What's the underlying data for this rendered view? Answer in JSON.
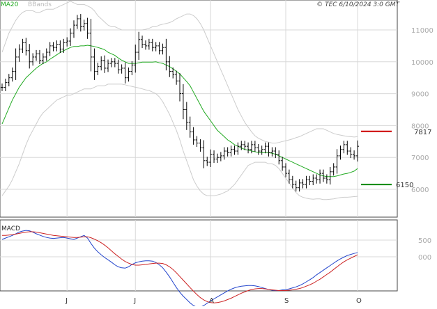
{
  "header": {
    "legend_ma": "MA20",
    "legend_bb": "BBands",
    "copyright": "© TEC 6/10/2024 3:0 GMT"
  },
  "colors": {
    "ma": "#22aa22",
    "bbands": "#cccccc",
    "price": "#000000",
    "macd_line": "#2244cc",
    "signal_line": "#cc2222",
    "resistance": "#cc0000",
    "support": "#008800",
    "grid": "#d8d8d8"
  },
  "chart_data": [
    {
      "type": "line",
      "subtype": "ohlc",
      "title": "",
      "y_ticks": [
        "11000",
        "10000",
        "9000",
        "8000",
        "7000",
        "6000"
      ],
      "y_tick_values": [
        11000,
        10000,
        9000,
        8000,
        7000,
        6000
      ],
      "ylim": [
        5300,
        11900
      ],
      "x_month_labels": [
        "J",
        "J",
        "A",
        "S",
        "O"
      ],
      "x_month_index": [
        19,
        39,
        61,
        83,
        104
      ],
      "grid": true,
      "levels": [
        {
          "name": "resistance",
          "value": 7817,
          "label": "7817"
        },
        {
          "name": "support",
          "value": 6150,
          "label": "6150"
        }
      ],
      "close": [
        9200,
        9350,
        9500,
        9700,
        10150,
        10400,
        10600,
        10350,
        10000,
        10150,
        10250,
        10050,
        10150,
        10300,
        10500,
        10450,
        10550,
        10400,
        10600,
        10650,
        10900,
        11150,
        11350,
        11100,
        11200,
        10900,
        10150,
        9700,
        9850,
        10050,
        9800,
        9950,
        10000,
        9950,
        9750,
        9800,
        9500,
        9700,
        9900,
        10300,
        10700,
        10550,
        10500,
        10600,
        10450,
        10500,
        10350,
        10450,
        10000,
        9700,
        9600,
        9400,
        9000,
        8500,
        8100,
        7800,
        7550,
        7450,
        7300,
        6900,
        6850,
        7100,
        6950,
        7000,
        7050,
        7200,
        7150,
        7250,
        7200,
        7350,
        7400,
        7350,
        7250,
        7400,
        7300,
        7200,
        7250,
        7350,
        7150,
        7200,
        7100,
        6900,
        6700,
        6500,
        6300,
        6150,
        6050,
        6200,
        6150,
        6300,
        6250,
        6350,
        6300,
        6500,
        6350,
        6300,
        6550,
        6700,
        7050,
        7250,
        7400,
        7200,
        7100,
        7050,
        7350
      ],
      "ma20": [
        8050,
        8300,
        8550,
        8800,
        9000,
        9200,
        9350,
        9500,
        9600,
        9700,
        9800,
        9880,
        9950,
        10000,
        10080,
        10150,
        10220,
        10290,
        10350,
        10400,
        10450,
        10480,
        10480,
        10500,
        10500,
        10520,
        10500,
        10480,
        10450,
        10420,
        10380,
        10300,
        10250,
        10200,
        10120,
        10050,
        10000,
        9950,
        9950,
        9950,
        9970,
        9990,
        9990,
        9990,
        9990,
        10000,
        9970,
        9950,
        9900,
        9850,
        9780,
        9700,
        9620,
        9500,
        9380,
        9250,
        9050,
        8850,
        8650,
        8450,
        8300,
        8150,
        8000,
        7850,
        7750,
        7650,
        7550,
        7480,
        7400,
        7350,
        7300,
        7250,
        7230,
        7200,
        7180,
        7150,
        7150,
        7150,
        7150,
        7130,
        7100,
        7050,
        7000,
        6950,
        6900,
        6850,
        6800,
        6750,
        6700,
        6650,
        6600,
        6550,
        6500,
        6450,
        6420,
        6400,
        6400,
        6400,
        6420,
        6450,
        6480,
        6500,
        6530,
        6570,
        6650
      ],
      "bb_upper": [
        10300,
        10600,
        10900,
        11100,
        11300,
        11450,
        11550,
        11600,
        11600,
        11600,
        11550,
        11550,
        11600,
        11650,
        11650,
        11650,
        11700,
        11750,
        11800,
        11850,
        11900,
        11850,
        11800,
        11800,
        11800,
        11750,
        11700,
        11600,
        11450,
        11350,
        11250,
        11150,
        11100,
        11100,
        11050,
        11000,
        11000,
        11000,
        11000,
        11000,
        11000,
        11000,
        11020,
        11050,
        11100,
        11100,
        11150,
        11180,
        11200,
        11230,
        11280,
        11350,
        11400,
        11450,
        11500,
        11500,
        11450,
        11350,
        11200,
        11000,
        10750,
        10500,
        10250,
        10000,
        9750,
        9500,
        9250,
        9000,
        8750,
        8500,
        8300,
        8100,
        7950,
        7800,
        7680,
        7600,
        7550,
        7500,
        7480,
        7450,
        7450,
        7470,
        7500,
        7520,
        7550,
        7580,
        7620,
        7650,
        7700,
        7750,
        7800,
        7850,
        7900,
        7900,
        7900,
        7850,
        7800,
        7750,
        7720,
        7700,
        7680,
        7660,
        7650,
        7640,
        7650
      ],
      "bb_lower": [
        5800,
        5950,
        6100,
        6300,
        6550,
        6800,
        7100,
        7400,
        7650,
        7850,
        8050,
        8250,
        8400,
        8500,
        8600,
        8700,
        8800,
        8850,
        8900,
        8950,
        8950,
        9000,
        9050,
        9100,
        9150,
        9150,
        9150,
        9200,
        9250,
        9250,
        9250,
        9300,
        9300,
        9300,
        9300,
        9300,
        9280,
        9250,
        9230,
        9200,
        9180,
        9150,
        9120,
        9100,
        9050,
        9000,
        8900,
        8750,
        8550,
        8350,
        8100,
        7850,
        7550,
        7200,
        6900,
        6600,
        6300,
        6100,
        5950,
        5850,
        5800,
        5800,
        5800,
        5820,
        5850,
        5900,
        5950,
        6050,
        6150,
        6300,
        6450,
        6600,
        6750,
        6800,
        6850,
        6850,
        6850,
        6850,
        6800,
        6800,
        6750,
        6650,
        6500,
        6350,
        6200,
        6050,
        5900,
        5800,
        5750,
        5720,
        5700,
        5690,
        5700,
        5700,
        5680,
        5680,
        5690,
        5700,
        5720,
        5740,
        5750,
        5750,
        5760,
        5770,
        5780
      ]
    },
    {
      "type": "line",
      "title": "MACD",
      "y_ticks": [
        "500",
        "000"
      ],
      "y_tick_values": [
        500,
        0
      ],
      "ylim": [
        -1800,
        900
      ],
      "grid": true,
      "series": [
        {
          "name": "macd",
          "values": [
            520,
            560,
            600,
            640,
            690,
            740,
            770,
            790,
            780,
            740,
            690,
            650,
            610,
            580,
            560,
            550,
            560,
            570,
            580,
            560,
            540,
            520,
            560,
            600,
            640,
            560,
            400,
            260,
            150,
            60,
            -20,
            -90,
            -160,
            -240,
            -300,
            -330,
            -340,
            -300,
            -230,
            -180,
            -150,
            -130,
            -120,
            -120,
            -130,
            -170,
            -240,
            -330,
            -460,
            -600,
            -760,
            -920,
            -1060,
            -1180,
            -1280,
            -1380,
            -1460,
            -1510,
            -1510,
            -1460,
            -1390,
            -1320,
            -1260,
            -1200,
            -1140,
            -1080,
            -1020,
            -970,
            -930,
            -900,
            -880,
            -870,
            -860,
            -860,
            -870,
            -890,
            -920,
            -950,
            -980,
            -1000,
            -1010,
            -1010,
            -990,
            -980,
            -960,
            -930,
            -900,
            -860,
            -810,
            -750,
            -690,
            -620,
            -540,
            -470,
            -400,
            -330,
            -260,
            -190,
            -120,
            -60,
            -10,
            40,
            70,
            100,
            130
          ]
        },
        {
          "name": "signal",
          "values": [
            640,
            640,
            650,
            660,
            680,
            700,
            720,
            740,
            750,
            750,
            740,
            720,
            700,
            680,
            660,
            640,
            630,
            620,
            610,
            600,
            590,
            580,
            580,
            590,
            600,
            600,
            570,
            530,
            480,
            420,
            350,
            270,
            180,
            90,
            10,
            -70,
            -140,
            -190,
            -230,
            -250,
            -250,
            -240,
            -230,
            -215,
            -200,
            -190,
            -190,
            -200,
            -240,
            -300,
            -380,
            -480,
            -590,
            -700,
            -810,
            -920,
            -1030,
            -1130,
            -1220,
            -1290,
            -1340,
            -1370,
            -1380,
            -1370,
            -1350,
            -1320,
            -1280,
            -1240,
            -1190,
            -1140,
            -1090,
            -1050,
            -1010,
            -980,
            -960,
            -950,
            -950,
            -960,
            -980,
            -990,
            -1000,
            -1010,
            -1010,
            -1010,
            -1000,
            -990,
            -970,
            -950,
            -920,
            -880,
            -840,
            -790,
            -730,
            -670,
            -600,
            -530,
            -460,
            -380,
            -300,
            -220,
            -150,
            -90,
            -40,
            10,
            60
          ]
        }
      ]
    }
  ]
}
